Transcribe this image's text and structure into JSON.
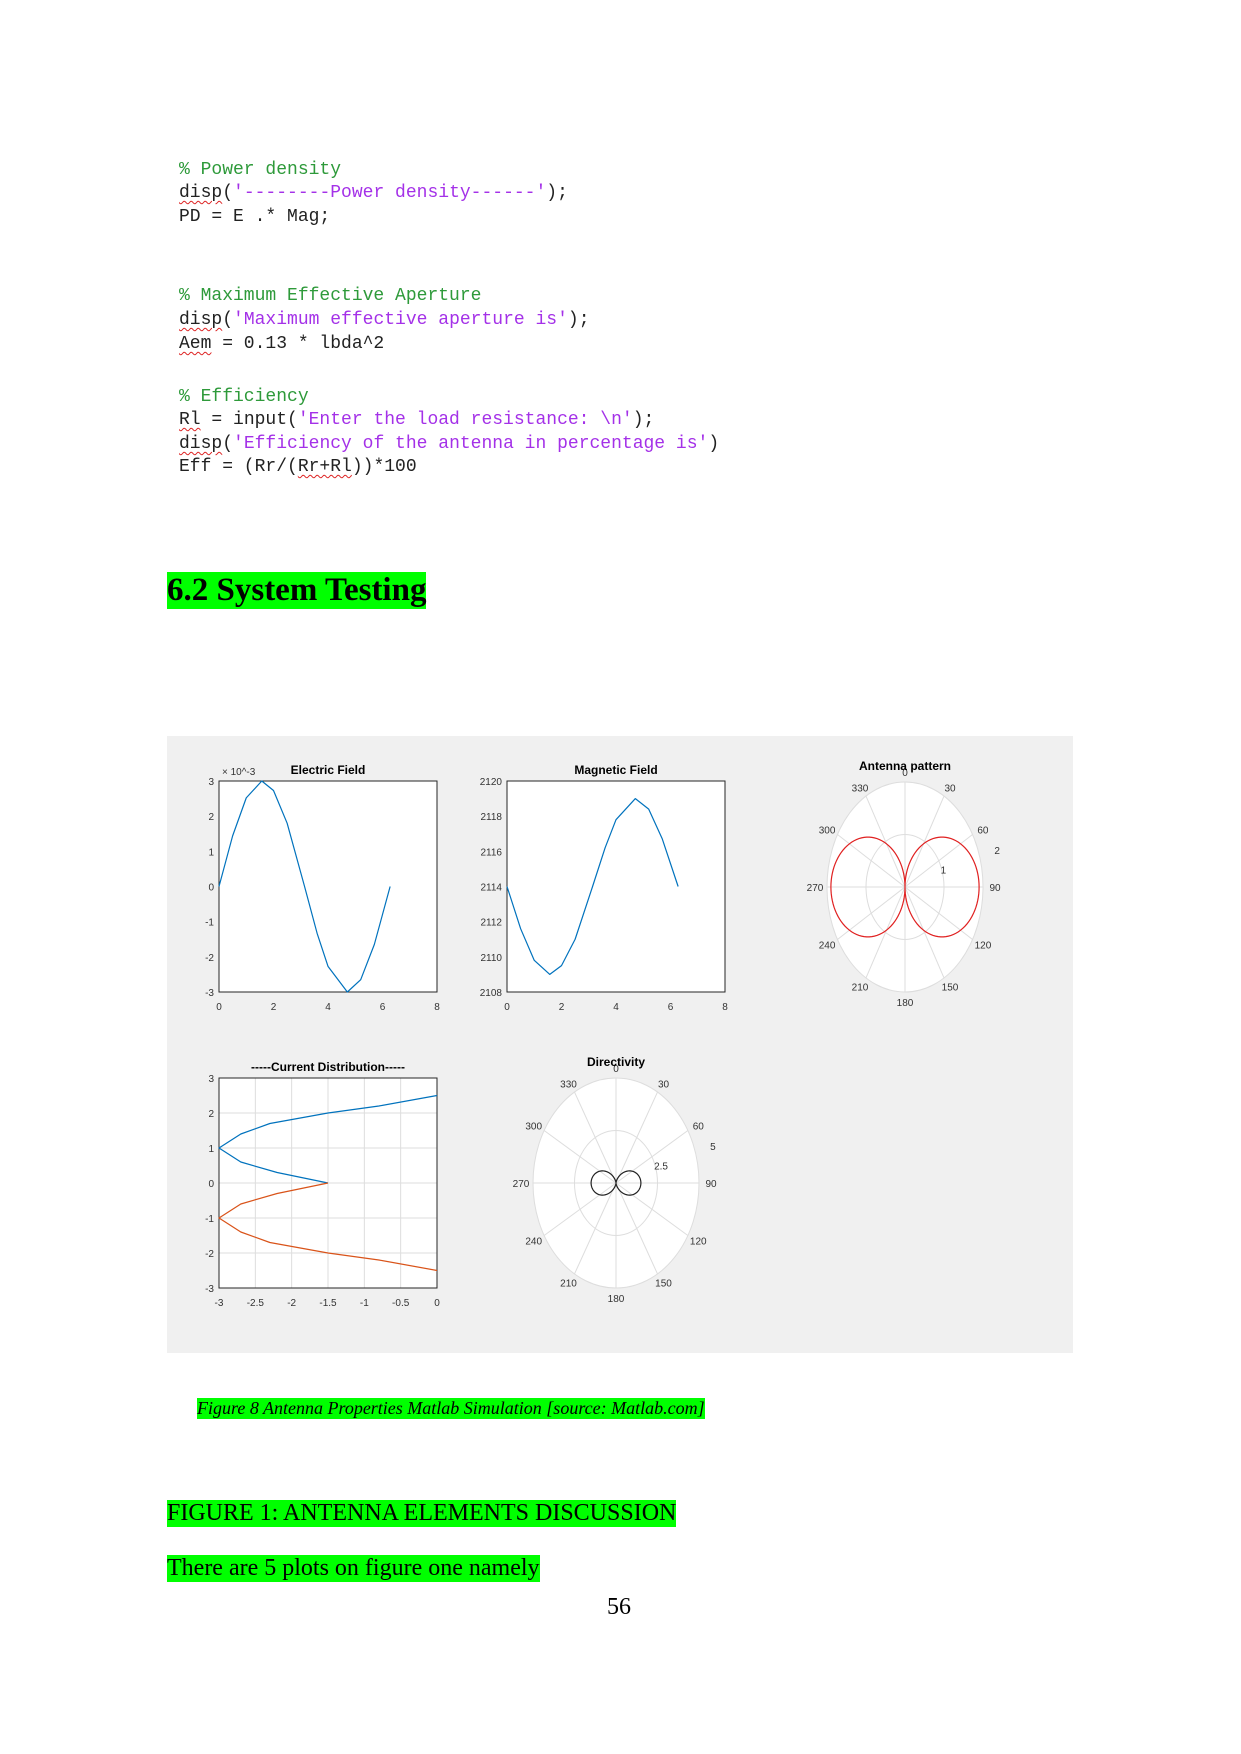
{
  "code_lines": [
    [
      {
        "t": "% Power density",
        "c": "cm"
      }
    ],
    [
      {
        "t": "disp",
        "c": "sq"
      },
      {
        "t": "("
      },
      {
        "t": "'--------Power density------'",
        "c": "st"
      },
      {
        "t": ");"
      }
    ],
    [
      {
        "t": "PD = E .* Mag;"
      }
    ],
    [
      {
        "t": "% Maximum Effective Aperture",
        "c": "cm"
      }
    ],
    [
      {
        "t": "disp",
        "c": "sq"
      },
      {
        "t": "("
      },
      {
        "t": "'Maximum effective aperture is'",
        "c": "st"
      },
      {
        "t": ");"
      }
    ],
    [
      {
        "t": "Aem",
        "c": "sq"
      },
      {
        "t": " = 0.13 * lbda^2"
      }
    ],
    [
      {
        "t": "% Efficiency",
        "c": "cm"
      }
    ],
    [
      {
        "t": "Rl",
        "c": "sq"
      },
      {
        "t": " = input("
      },
      {
        "t": "'Enter the load resistance: \\n'",
        "c": "st"
      },
      {
        "t": ");"
      }
    ],
    [
      {
        "t": "disp",
        "c": "sq"
      },
      {
        "t": "("
      },
      {
        "t": "'Efficiency of the antenna in percentage is'",
        "c": "st"
      },
      {
        "t": ")"
      }
    ],
    [
      {
        "t": "Eff = (Rr/("
      },
      {
        "t": "Rr+Rl",
        "c": "sq"
      },
      {
        "t": "))*100"
      }
    ]
  ],
  "heading": "6.2 System Testing",
  "caption": "Figure 8 Antenna Properties Matlab Simulation [source: Matlab.com]",
  "figure_heading": "FIGURE 1: ANTENNA ELEMENTS DISCUSSION",
  "paragraph": "There are 5 plots on figure one namely",
  "page_number": "56",
  "colors": {
    "highlight": "#00ff00",
    "comment": "#2e9a3a",
    "string": "#a431e8",
    "series_blue": "#0072bd",
    "series_red": "#d95319",
    "polar_red": "#e02020"
  },
  "chart_data": [
    {
      "type": "line",
      "title": "Electric Field",
      "exponent_label": "× 10^-3",
      "xlim": [
        0,
        8
      ],
      "ylim": [
        -3,
        3
      ],
      "xticks": [
        "0",
        "2",
        "4",
        "6",
        "8"
      ],
      "yticks": [
        "-3",
        "-2",
        "-1",
        "0",
        "1",
        "2",
        "3"
      ],
      "series": [
        {
          "x": [
            0,
            0.5,
            1,
            1.57,
            2,
            2.5,
            3.14,
            3.6,
            4,
            4.71,
            5.2,
            5.7,
            6.28
          ],
          "y": [
            0,
            1.44,
            2.52,
            3,
            2.73,
            1.8,
            0,
            -1.33,
            -2.27,
            -3,
            -2.65,
            -1.65,
            0
          ]
        }
      ]
    },
    {
      "type": "line",
      "title": "Magnetic Field",
      "xlim": [
        0,
        8
      ],
      "ylim": [
        2108,
        2120
      ],
      "xticks": [
        "0",
        "2",
        "4",
        "6",
        "8"
      ],
      "yticks": [
        "2108",
        "2110",
        "2112",
        "2114",
        "2116",
        "2118",
        "2120"
      ],
      "series": [
        {
          "x": [
            0,
            0.5,
            1,
            1.57,
            2,
            2.5,
            3.14,
            3.6,
            4,
            4.71,
            5.2,
            5.7,
            6.28
          ],
          "y": [
            2114,
            2111.6,
            2109.8,
            2109,
            2109.5,
            2111,
            2114,
            2116.2,
            2117.8,
            2119,
            2118.4,
            2116.7,
            2114
          ]
        }
      ]
    },
    {
      "type": "polar",
      "title": "Antenna pattern",
      "rticks": [
        "1",
        "2"
      ],
      "rmax": 2,
      "angle_ticks": [
        "0",
        "30",
        "60",
        "90",
        "120",
        "150",
        "180",
        "210",
        "240",
        "270",
        "300",
        "330"
      ],
      "pattern": "1.9*|sin(theta)|",
      "color": "#e02020"
    },
    {
      "type": "line",
      "title": "-----Current Distribution-----",
      "xlim": [
        -3,
        0
      ],
      "ylim": [
        -3,
        3
      ],
      "xticks": [
        "-3",
        "-2.5",
        "-2",
        "-1.5",
        "-1",
        "-0.5",
        "0"
      ],
      "yticks": [
        "-3",
        "-2",
        "-1",
        "0",
        "1",
        "2",
        "3"
      ],
      "grid": true,
      "series": [
        {
          "x": [
            -1.5,
            -2.2,
            -2.7,
            -3,
            -2.7,
            -2.3,
            -1.5,
            -0.8,
            0
          ],
          "y": [
            0,
            0.3,
            0.6,
            1,
            1.4,
            1.7,
            2,
            2.2,
            2.5
          ]
        },
        {
          "x": [
            -1.5,
            -2.2,
            -2.7,
            -3,
            -2.7,
            -2.3,
            -1.5,
            -0.8,
            0
          ],
          "y": [
            0,
            -0.3,
            -0.6,
            -1,
            -1.4,
            -1.7,
            -2,
            -2.2,
            -2.5
          ]
        }
      ]
    },
    {
      "type": "polar",
      "title": "Directivity",
      "rticks": [
        "2.5",
        "5"
      ],
      "rmax": 5,
      "angle_ticks": [
        "0",
        "30",
        "60",
        "90",
        "120",
        "150",
        "180",
        "210",
        "240",
        "270",
        "300",
        "330"
      ],
      "pattern": "1.5*sin(theta)^2",
      "color": "#222222"
    }
  ]
}
